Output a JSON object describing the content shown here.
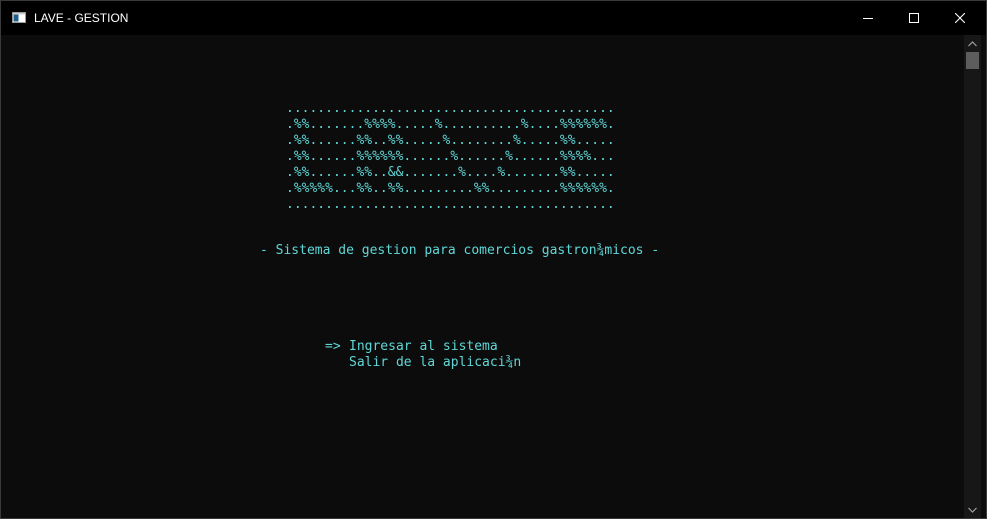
{
  "window": {
    "title": "LAVE - GESTION"
  },
  "console": {
    "banner": [
      "..........................................",
      ".%%.......%%%%.....%..........%....%%%%%%.",
      ".%%......%%..%%.....%........%.....%%.....",
      ".%%......%%%%%%......%......%......%%%%...",
      ".%%......%%..&&.......%....%.......%%.....",
      ".%%%%%...%%..%%.........%%.........%%%%%%.",
      ".........................................."
    ],
    "subtitle": "- Sistema de gestion para comercios gastron¾micos -",
    "menu": {
      "cursor": "=>",
      "items": [
        "Ingresar al sistema",
        "Salir de la aplicaci¾n"
      ],
      "selected_index": 0
    }
  },
  "icons": {
    "app": "terminal-app-icon",
    "minimize": "minimize-icon",
    "maximize": "maximize-icon",
    "close": "close-icon",
    "scroll_up": "chevron-up-icon",
    "scroll_down": "chevron-down-icon"
  },
  "colors": {
    "console_text": "#61d6d6",
    "console_background": "#0c0c0c",
    "titlebar_background": "#000000"
  }
}
